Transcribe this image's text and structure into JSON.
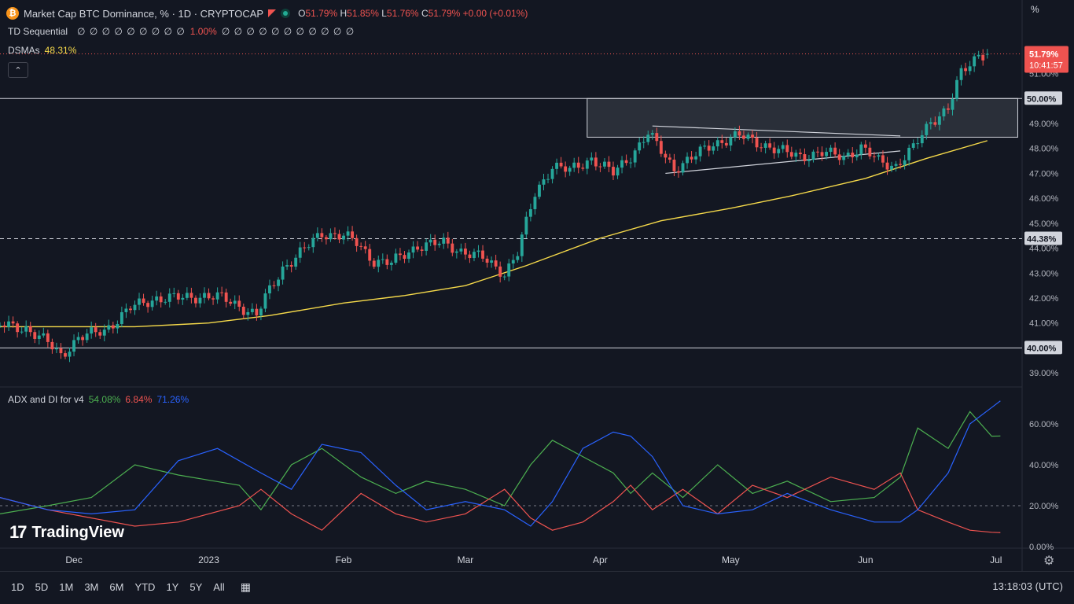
{
  "header": {
    "title": "Market Cap BTC Dominance, % · 1D · CRYPTOCAP",
    "btc_symbol": "₿",
    "o_label": "O",
    "o": "51.79%",
    "h_label": "H",
    "h": "51.85%",
    "l_label": "L",
    "l": "51.76%",
    "c_label": "C",
    "c": "51.79%",
    "change": "+0.00 (+0.01%)"
  },
  "indicators": {
    "td_label": "TD Sequential",
    "td_values_a": "∅ ∅ ∅ ∅ ∅ ∅ ∅ ∅ ∅",
    "td_value_red": "1.00%",
    "td_values_b": "∅ ∅ ∅ ∅ ∅ ∅ ∅ ∅ ∅ ∅ ∅",
    "dsma_label": "DSMAs",
    "dsma_value": "48.31%",
    "adx_label": "ADX and DI for v4",
    "adx_value": "54.08%",
    "di_minus_value": "6.84%",
    "di_plus_value": "71.26%",
    "collapse_glyph": "⌃"
  },
  "axis": {
    "unit": "%",
    "ticks": [
      "52.00%",
      "51.00%",
      "50.00%",
      "49.00%",
      "48.00%",
      "47.00%",
      "46.00%",
      "45.00%",
      "44.00%",
      "43.00%",
      "42.00%",
      "41.00%",
      "40.00%",
      "39.00%"
    ],
    "adx_ticks": [
      "60.00%",
      "40.00%",
      "20.00%",
      "0.00%"
    ],
    "price_tag": "51.79%",
    "countdown": "10:41:57",
    "hline_tags": [
      "50.00%",
      "44.38%",
      "40.00%"
    ],
    "x_labels": [
      "Dec",
      "2023",
      "Feb",
      "Mar",
      "Apr",
      "May",
      "Jun",
      "Jul"
    ]
  },
  "bottom": {
    "ranges": [
      "1D",
      "5D",
      "1M",
      "3M",
      "6M",
      "YTD",
      "1Y",
      "5Y",
      "All"
    ],
    "clock": "13:18:03 (UTC)",
    "logo_text": "TradingView",
    "logo_mark": "17"
  },
  "colors": {
    "bg": "#131722",
    "up": "#26a69a",
    "down": "#ef5350",
    "dsma": "#f5d94a",
    "adx": "#4caf50",
    "di_minus": "#ef5350",
    "di_plus": "#2962ff"
  },
  "chart_data": [
    {
      "type": "candlestick",
      "title": "Market Cap BTC Dominance, % · 1D · CRYPTOCAP",
      "ylim": [
        38.5,
        52.5
      ],
      "x_start": "2022-11-14",
      "x_end": "2023-07-07",
      "x_ticks": [
        {
          "label": "Dec",
          "date": "2022-12-01"
        },
        {
          "label": "2023",
          "date": "2023-01-01"
        },
        {
          "label": "Feb",
          "date": "2023-02-01"
        },
        {
          "label": "Mar",
          "date": "2023-03-01"
        },
        {
          "label": "Apr",
          "date": "2023-04-01"
        },
        {
          "label": "May",
          "date": "2023-05-01"
        },
        {
          "label": "Jun",
          "date": "2023-06-01"
        },
        {
          "label": "Jul",
          "date": "2023-07-01"
        }
      ],
      "close_path": [
        [
          "2022-11-14",
          40.9
        ],
        [
          "2022-11-20",
          40.8
        ],
        [
          "2022-11-25",
          40.2
        ],
        [
          "2022-11-28",
          39.7
        ],
        [
          "2022-12-02",
          40.4
        ],
        [
          "2022-12-08",
          40.7
        ],
        [
          "2022-12-14",
          41.6
        ],
        [
          "2022-12-20",
          42.0
        ],
        [
          "2022-12-26",
          42.0
        ],
        [
          "2022-12-31",
          42.1
        ],
        [
          "2023-01-04",
          42.0
        ],
        [
          "2023-01-08",
          41.7
        ],
        [
          "2023-01-12",
          41.3
        ],
        [
          "2023-01-14",
          42.0
        ],
        [
          "2023-01-18",
          43.2
        ],
        [
          "2023-01-22",
          43.8
        ],
        [
          "2023-01-27",
          44.6
        ],
        [
          "2023-02-01",
          44.5
        ],
        [
          "2023-02-04",
          44.2
        ],
        [
          "2023-02-08",
          43.5
        ],
        [
          "2023-02-12",
          43.4
        ],
        [
          "2023-02-18",
          44.1
        ],
        [
          "2023-02-24",
          44.2
        ],
        [
          "2023-02-28",
          43.9
        ],
        [
          "2023-03-05",
          43.6
        ],
        [
          "2023-03-10",
          43.0
        ],
        [
          "2023-03-13",
          43.8
        ],
        [
          "2023-03-17",
          46.2
        ],
        [
          "2023-03-21",
          47.3
        ],
        [
          "2023-03-25",
          47.1
        ],
        [
          "2023-03-30",
          47.6
        ],
        [
          "2023-04-04",
          47.0
        ],
        [
          "2023-04-08",
          47.7
        ],
        [
          "2023-04-12",
          48.6
        ],
        [
          "2023-04-18",
          47.2
        ],
        [
          "2023-04-22",
          47.6
        ],
        [
          "2023-04-27",
          48.2
        ],
        [
          "2023-05-03",
          48.5
        ],
        [
          "2023-05-08",
          48.2
        ],
        [
          "2023-05-12",
          47.9
        ],
        [
          "2023-05-17",
          47.7
        ],
        [
          "2023-05-22",
          47.8
        ],
        [
          "2023-05-27",
          47.7
        ],
        [
          "2023-05-31",
          48.0
        ],
        [
          "2023-06-04",
          47.5
        ],
        [
          "2023-06-08",
          47.3
        ],
        [
          "2023-06-12",
          48.0
        ],
        [
          "2023-06-16",
          49.1
        ],
        [
          "2023-06-20",
          49.6
        ],
        [
          "2023-06-23",
          51.0
        ],
        [
          "2023-06-27",
          51.8
        ],
        [
          "2023-06-29",
          51.79
        ]
      ],
      "last": {
        "open": 51.79,
        "high": 51.85,
        "low": 51.76,
        "close": 51.79,
        "change": "+0.00 (+0.01%)"
      },
      "dsma": [
        [
          "2022-11-14",
          40.85
        ],
        [
          "2022-12-15",
          40.85
        ],
        [
          "2023-01-01",
          41.0
        ],
        [
          "2023-01-15",
          41.3
        ],
        [
          "2023-02-01",
          41.8
        ],
        [
          "2023-02-15",
          42.1
        ],
        [
          "2023-03-01",
          42.5
        ],
        [
          "2023-03-15",
          43.3
        ],
        [
          "2023-04-01",
          44.4
        ],
        [
          "2023-04-15",
          45.1
        ],
        [
          "2023-05-01",
          45.6
        ],
        [
          "2023-05-15",
          46.1
        ],
        [
          "2023-06-01",
          46.8
        ],
        [
          "2023-06-15",
          47.6
        ],
        [
          "2023-06-29",
          48.31
        ]
      ],
      "dsma_last": 48.31,
      "horizontal_lines": [
        50.0,
        44.38,
        40.0
      ],
      "zone": {
        "from": "2023-03-29",
        "to": "2023-07-06",
        "low": 48.45,
        "high": 50.0
      },
      "trendlines": [
        {
          "from": [
            "2023-04-13",
            48.9
          ],
          "to": [
            "2023-06-09",
            48.5
          ]
        },
        {
          "from": [
            "2023-04-16",
            47.0
          ],
          "to": [
            "2023-06-09",
            47.9
          ]
        }
      ]
    },
    {
      "type": "line",
      "title": "ADX and DI for v4",
      "ylim": [
        0,
        75
      ],
      "series": [
        {
          "name": "ADX",
          "color": "#4caf50",
          "points": [
            [
              "2022-11-14",
              16
            ],
            [
              "2022-11-25",
              20
            ],
            [
              "2022-12-05",
              24
            ],
            [
              "2022-12-15",
              40
            ],
            [
              "2022-12-25",
              35
            ],
            [
              "2023-01-08",
              30
            ],
            [
              "2023-01-13",
              18
            ],
            [
              "2023-01-20",
              40
            ],
            [
              "2023-01-27",
              48
            ],
            [
              "2023-02-05",
              34
            ],
            [
              "2023-02-13",
              26
            ],
            [
              "2023-02-20",
              32
            ],
            [
              "2023-03-01",
              28
            ],
            [
              "2023-03-10",
              20
            ],
            [
              "2023-03-16",
              40
            ],
            [
              "2023-03-21",
              52
            ],
            [
              "2023-03-28",
              44
            ],
            [
              "2023-04-04",
              36
            ],
            [
              "2023-04-08",
              26
            ],
            [
              "2023-04-13",
              36
            ],
            [
              "2023-04-20",
              24
            ],
            [
              "2023-04-28",
              40
            ],
            [
              "2023-05-06",
              26
            ],
            [
              "2023-05-14",
              32
            ],
            [
              "2023-05-24",
              22
            ],
            [
              "2023-06-03",
              24
            ],
            [
              "2023-06-09",
              34
            ],
            [
              "2023-06-13",
              58
            ],
            [
              "2023-06-20",
              48
            ],
            [
              "2023-06-25",
              66
            ],
            [
              "2023-06-30",
              54
            ],
            [
              "2023-07-02",
              54.08
            ]
          ]
        },
        {
          "name": "-DI",
          "color": "#ef5350",
          "points": [
            [
              "2022-11-14",
              24
            ],
            [
              "2022-11-25",
              18
            ],
            [
              "2022-12-05",
              14
            ],
            [
              "2022-12-15",
              10
            ],
            [
              "2022-12-25",
              12
            ],
            [
              "2023-01-08",
              20
            ],
            [
              "2023-01-13",
              28
            ],
            [
              "2023-01-20",
              16
            ],
            [
              "2023-01-27",
              8
            ],
            [
              "2023-02-05",
              26
            ],
            [
              "2023-02-13",
              16
            ],
            [
              "2023-02-20",
              12
            ],
            [
              "2023-03-01",
              16
            ],
            [
              "2023-03-10",
              28
            ],
            [
              "2023-03-16",
              14
            ],
            [
              "2023-03-21",
              8
            ],
            [
              "2023-03-28",
              12
            ],
            [
              "2023-04-04",
              22
            ],
            [
              "2023-04-08",
              30
            ],
            [
              "2023-04-13",
              18
            ],
            [
              "2023-04-20",
              28
            ],
            [
              "2023-04-28",
              16
            ],
            [
              "2023-05-06",
              30
            ],
            [
              "2023-05-14",
              24
            ],
            [
              "2023-05-24",
              34
            ],
            [
              "2023-06-03",
              28
            ],
            [
              "2023-06-09",
              36
            ],
            [
              "2023-06-13",
              18
            ],
            [
              "2023-06-20",
              12
            ],
            [
              "2023-06-25",
              8
            ],
            [
              "2023-06-30",
              7
            ],
            [
              "2023-07-02",
              6.84
            ]
          ]
        },
        {
          "name": "+DI",
          "color": "#2962ff",
          "points": [
            [
              "2022-11-14",
              24
            ],
            [
              "2022-11-25",
              18
            ],
            [
              "2022-12-05",
              16
            ],
            [
              "2022-12-15",
              18
            ],
            [
              "2022-12-25",
              42
            ],
            [
              "2023-01-03",
              48
            ],
            [
              "2023-01-13",
              36
            ],
            [
              "2023-01-20",
              28
            ],
            [
              "2023-01-27",
              50
            ],
            [
              "2023-02-05",
              46
            ],
            [
              "2023-02-13",
              30
            ],
            [
              "2023-02-20",
              18
            ],
            [
              "2023-03-01",
              22
            ],
            [
              "2023-03-10",
              18
            ],
            [
              "2023-03-16",
              10
            ],
            [
              "2023-03-21",
              22
            ],
            [
              "2023-03-28",
              48
            ],
            [
              "2023-04-04",
              56
            ],
            [
              "2023-04-08",
              54
            ],
            [
              "2023-04-13",
              44
            ],
            [
              "2023-04-20",
              20
            ],
            [
              "2023-04-28",
              16
            ],
            [
              "2023-05-06",
              18
            ],
            [
              "2023-05-14",
              26
            ],
            [
              "2023-05-24",
              18
            ],
            [
              "2023-06-03",
              12
            ],
            [
              "2023-06-09",
              12
            ],
            [
              "2023-06-13",
              18
            ],
            [
              "2023-06-20",
              36
            ],
            [
              "2023-06-25",
              60
            ],
            [
              "2023-06-30",
              68
            ],
            [
              "2023-07-02",
              71.26
            ]
          ]
        }
      ],
      "reference_line": 20
    }
  ]
}
